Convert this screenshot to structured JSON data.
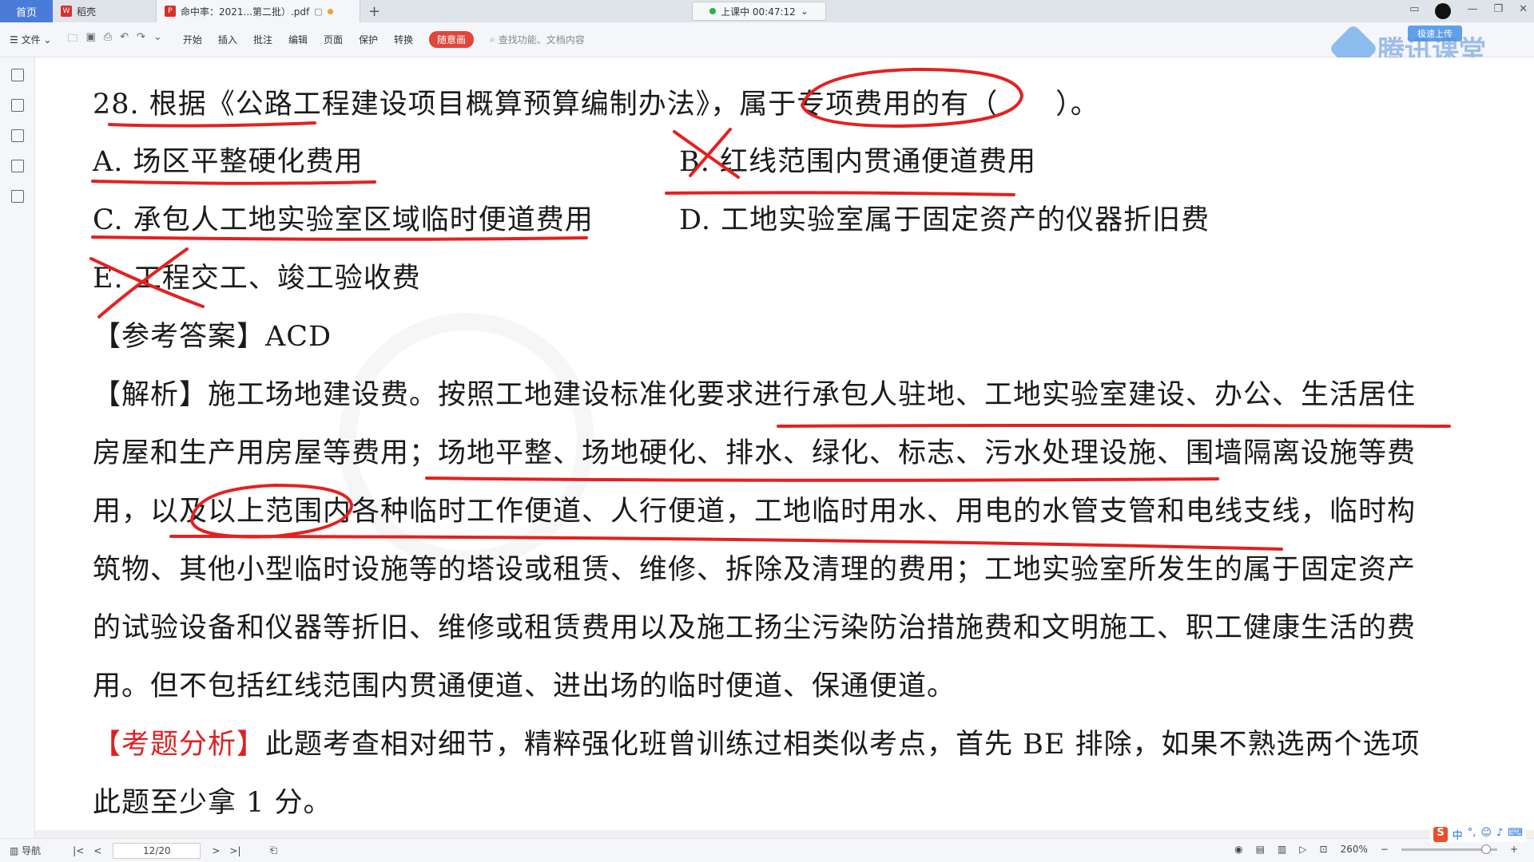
{
  "tabs": {
    "home": "首页",
    "straw": "稻壳",
    "pdf": "命中率：2021...第二批）.pdf",
    "add": "+"
  },
  "live": {
    "status": "上课中 00:47:12"
  },
  "toolbar": {
    "file": "文件",
    "items": [
      "开始",
      "插入",
      "批注",
      "编辑",
      "页面",
      "保护",
      "转换"
    ],
    "active": "随意画",
    "search_placeholder": "查找功能、文档内容",
    "upload": "极速上传"
  },
  "brand": {
    "text": "腾讯课堂"
  },
  "document": {
    "question": "28. 根据《公路工程建设项目概算预算编制办法》，属于专项费用的有（　　）。",
    "option_a": "A. 场区平整硬化费用",
    "option_b": "B. 红线范围内贯通便道费用",
    "option_c": "C. 承包人工地实验室区域临时便道费用",
    "option_d": "D. 工地实验室属于固定资产的仪器折旧费",
    "option_e": "E. 工程交工、竣工验收费",
    "answer": "【参考答案】ACD",
    "analysis_lines": [
      "【解析】施工场地建设费。按照工地建设标准化要求进行承包人驻地、工地实验室建设、办公、生活居住",
      "房屋和生产用房屋等费用；场地平整、场地硬化、排水、绿化、标志、污水处理设施、围墙隔离设施等费",
      "用，以及以上范围内各种临时工作便道、人行便道，工地临时用水、用电的水管支管和电线支线，临时构",
      "筑物、其他小型临时设施等的塔设或租赁、维修、拆除及清理的费用；工地实验室所发生的属于固定资产",
      "的试验设备和仪器等折旧、维修或租赁费用以及施工扬尘污染防治措施费和文明施工、职工健康生活的费",
      "用。但不包括红线范围内贯通便道、进出场的临时便道、保通便道。"
    ],
    "exam_analysis_label": "【考题分析】",
    "exam_analysis_text": "此题考查相对细节，精粹强化班曾训练过相类似考点，首先 BE 排除，如果不熟选两个选项",
    "exam_analysis_line2": "此题至少拿 1 分。"
  },
  "statusbar": {
    "nav": "导航",
    "page": "12/20",
    "zoom": "260%"
  },
  "ime": {
    "mode": "中"
  },
  "colors": {
    "accent": "#e0463b",
    "ink": "#e52020",
    "brand": "#3c8be8"
  }
}
